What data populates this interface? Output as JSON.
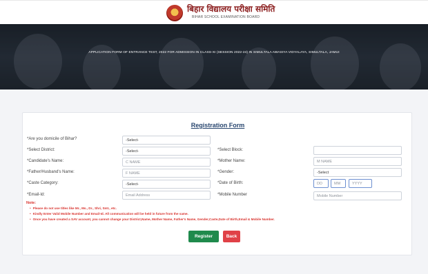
{
  "header": {
    "brand_hindi": "बिहार विद्यालय परीक्षा समिति",
    "brand_english": "BIHAR SCHOOL EXAMINATION BOARD",
    "logo_icon": "bseb-emblem-icon"
  },
  "banner": {
    "text": "APPLICATION FORM OF ENTRANCE TEST, 2022 FOR ADMISSION IN CLASS-XI (SESSION 2022-24) IN SIMULTALA AWASIYA VIDYALAYA, SIMULTALA, JAMUI"
  },
  "form": {
    "title": "Registration Form",
    "domicile": {
      "label": "*Are you domicile of Bihar?",
      "value": "-Select-"
    },
    "district": {
      "label": "*Select District:",
      "value": "-Select-"
    },
    "block": {
      "label": "*Select Block:",
      "value": ""
    },
    "candidate_name": {
      "label": "*Candidate's Name:",
      "placeholder": "C NAME"
    },
    "mother_name": {
      "label": "*Mother Name:",
      "placeholder": "M NAME"
    },
    "father_name": {
      "label": "*Father/Husband's Name:",
      "placeholder": "F NAME"
    },
    "gender": {
      "label": "*Gender:",
      "value": "-Select"
    },
    "caste": {
      "label": "*Caste Category:",
      "value": "-Select-"
    },
    "dob": {
      "label": "*Date of Birth:",
      "dd": "DD",
      "mm": "MM",
      "yyyy": "YYYY"
    },
    "email": {
      "label": "*Email-Id:",
      "placeholder": "Email Address"
    },
    "mobile": {
      "label": "*Mobile Number",
      "placeholder": "Mobile Number"
    }
  },
  "notes": {
    "title": "Note:",
    "items": [
      "Please do not use titles like Mr., Ms., Dr., Shri, Smt., etc.",
      "Kindly Enter Valid Mobile Number and Email-Id. All communication will be held in future from the same.",
      "Once you have created a SAV account, you cannot change your District,Name, Mother Name, Father's Name, Gender,Caste,Date of Birth,Email & Mobile Number."
    ]
  },
  "buttons": {
    "register": "Register",
    "back": "Back"
  },
  "colors": {
    "title": "#27456e",
    "note": "#d8322d",
    "register": "#1f8a4c",
    "back": "#e04147",
    "brand": "#8b1c1c"
  }
}
